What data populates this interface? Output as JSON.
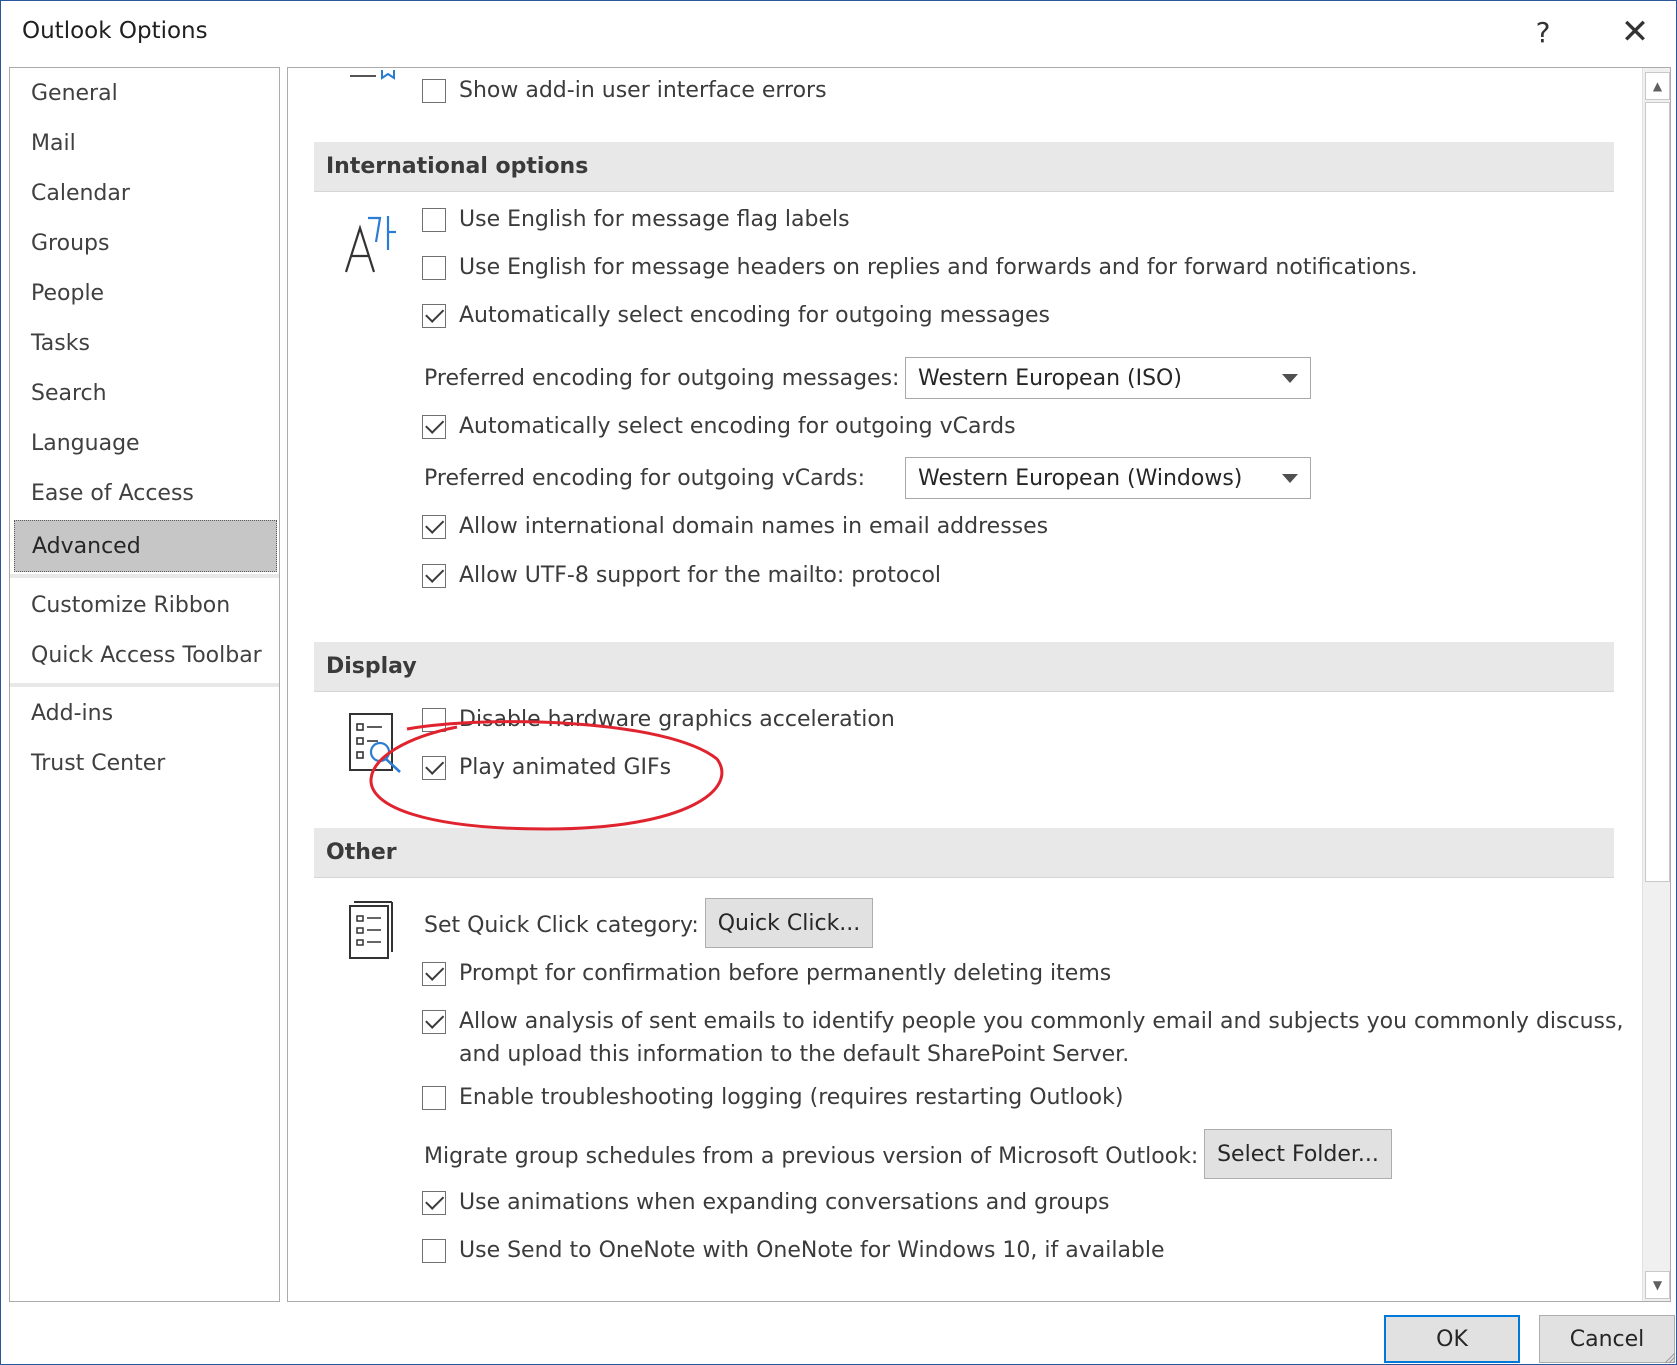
{
  "window": {
    "title": "Outlook Options",
    "help_glyph": "?",
    "close_glyph": "✕"
  },
  "sidebar": {
    "items": [
      {
        "label": "General"
      },
      {
        "label": "Mail"
      },
      {
        "label": "Calendar"
      },
      {
        "label": "Groups"
      },
      {
        "label": "People"
      },
      {
        "label": "Tasks"
      },
      {
        "label": "Search"
      },
      {
        "label": "Language"
      },
      {
        "label": "Ease of Access"
      },
      {
        "label": "Advanced",
        "selected": true
      },
      {
        "label": "Customize Ribbon"
      },
      {
        "label": "Quick Access Toolbar"
      },
      {
        "label": "Add-ins"
      },
      {
        "label": "Trust Center"
      }
    ]
  },
  "content": {
    "addin_errors": {
      "label": "Show add-in user interface errors",
      "checked": false
    },
    "international": {
      "header": "International options",
      "english_flag_labels": {
        "label": "Use English for message flag labels",
        "checked": false
      },
      "english_headers": {
        "label": "Use English for message headers on replies and forwards and for forward notifications.",
        "checked": false
      },
      "auto_encoding_messages": {
        "label": "Automatically select encoding for outgoing messages",
        "checked": true
      },
      "preferred_encoding_messages": {
        "label": "Preferred encoding for outgoing messages:",
        "value": "Western European (ISO)"
      },
      "auto_encoding_vcards": {
        "label": "Automatically select encoding for outgoing vCards",
        "checked": true
      },
      "preferred_encoding_vcards": {
        "label": "Preferred encoding for outgoing vCards:",
        "value": "Western European (Windows)"
      },
      "intl_domain_names": {
        "label": "Allow international domain names in email addresses",
        "checked": true
      },
      "utf8_mailto": {
        "label": "Allow UTF-8 support for the mailto: protocol",
        "checked": true
      }
    },
    "display": {
      "header": "Display",
      "disable_hw_accel": {
        "label": "Disable hardware graphics acceleration",
        "checked": false
      },
      "play_gifs": {
        "label": "Play animated GIFs",
        "checked": true
      }
    },
    "other": {
      "header": "Other",
      "quick_click": {
        "label": "Set Quick Click category:",
        "button": "Quick Click..."
      },
      "prompt_delete": {
        "label": "Prompt for confirmation before permanently deleting items",
        "checked": true
      },
      "allow_analysis": {
        "label": "Allow analysis of sent emails to identify people you commonly email and subjects you commonly discuss,",
        "label_line2": "and upload this information to the default SharePoint Server.",
        "checked": true
      },
      "troubleshooting": {
        "label": "Enable troubleshooting logging (requires restarting Outlook)",
        "checked": false
      },
      "migrate": {
        "label": "Migrate group schedules from a previous version of Microsoft Outlook:",
        "button": "Select Folder..."
      },
      "animations": {
        "label": "Use animations when expanding conversations and groups",
        "checked": true
      },
      "onenote": {
        "label": "Use Send to OneNote with OneNote for Windows 10, if available",
        "checked": false
      }
    }
  },
  "footer": {
    "ok": "OK",
    "cancel": "Cancel"
  },
  "colors": {
    "accent": "#0078d7",
    "annotation": "#e0242f"
  }
}
